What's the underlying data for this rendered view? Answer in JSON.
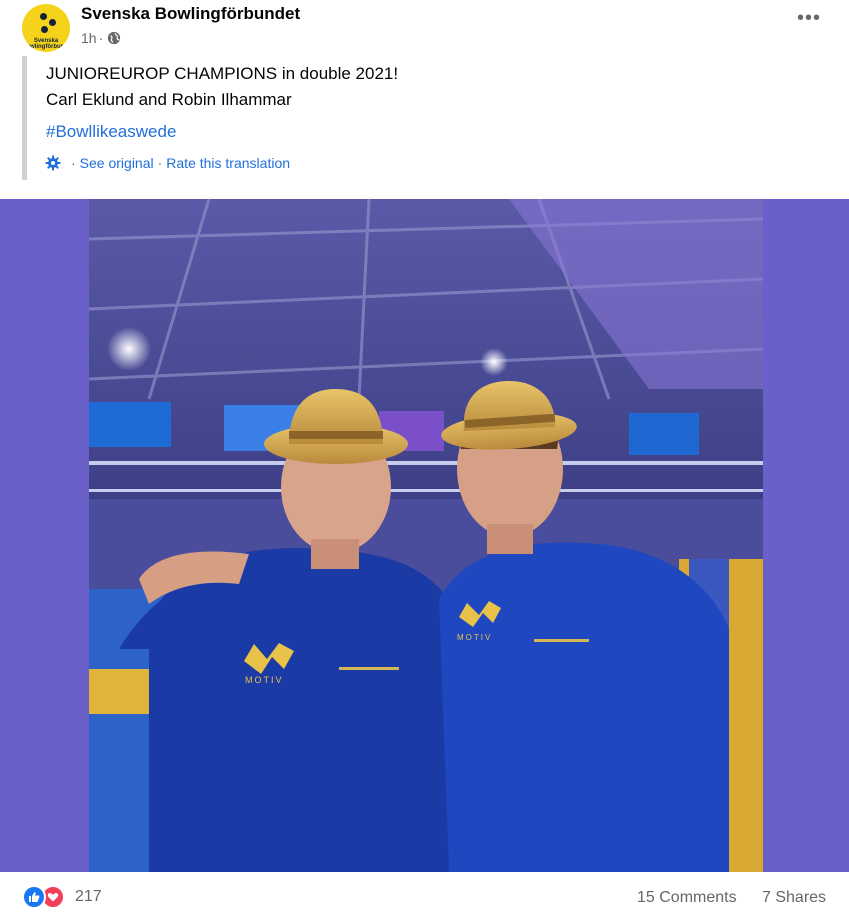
{
  "post": {
    "page_name": "Svenska Bowlingförbundet",
    "avatar_text": "Svenska Bowlingförbundet",
    "time": "1h",
    "audience_icon": "globe-icon",
    "more_icon": "ellipsis-icon",
    "text_line_1": "JUNIOREUROP CHAMPIONS in double 2021!",
    "text_line_2": "Carl Eklund and Robin Ilhammar",
    "hashtag": "#Bowllikeaswede",
    "translation": {
      "see_original": "See original",
      "rate": "Rate this translation"
    }
  },
  "photo": {
    "logo_text": "MOTIV"
  },
  "footer": {
    "reaction_icons": [
      "like-icon",
      "love-icon"
    ],
    "reaction_count": "217",
    "comments": "15 Comments",
    "shares": "7 Shares"
  },
  "colors": {
    "link": "#216fdb",
    "photo_background": "#6961c9",
    "like": "#1877f2",
    "love": "#f33e58"
  }
}
